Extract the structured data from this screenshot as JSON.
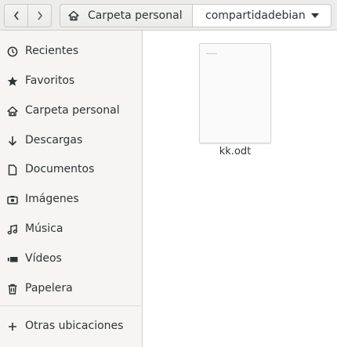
{
  "header": {
    "back_icon": "chevron-left-icon",
    "forward_icon": "chevron-right-icon",
    "path": [
      {
        "label": "Carpeta personal",
        "icon": "home-icon"
      },
      {
        "label": "compartidadebian",
        "icon": "caret-down-icon"
      }
    ]
  },
  "sidebar": {
    "items": [
      {
        "label": "Recientes",
        "icon": "clock-icon"
      },
      {
        "label": "Favoritos",
        "icon": "star-icon"
      },
      {
        "label": "Carpeta personal",
        "icon": "home-icon"
      },
      {
        "label": "Descargas",
        "icon": "download-icon"
      },
      {
        "label": "Documentos",
        "icon": "document-icon"
      },
      {
        "label": "Imágenes",
        "icon": "camera-icon"
      },
      {
        "label": "Música",
        "icon": "music-icon"
      },
      {
        "label": "Vídeos",
        "icon": "video-icon"
      },
      {
        "label": "Papelera",
        "icon": "trash-icon"
      },
      {
        "label": "Otras ubicaciones",
        "icon": "plus-icon"
      }
    ]
  },
  "files": [
    {
      "name": "kk.odt",
      "icon": "document-thumbnail"
    }
  ]
}
